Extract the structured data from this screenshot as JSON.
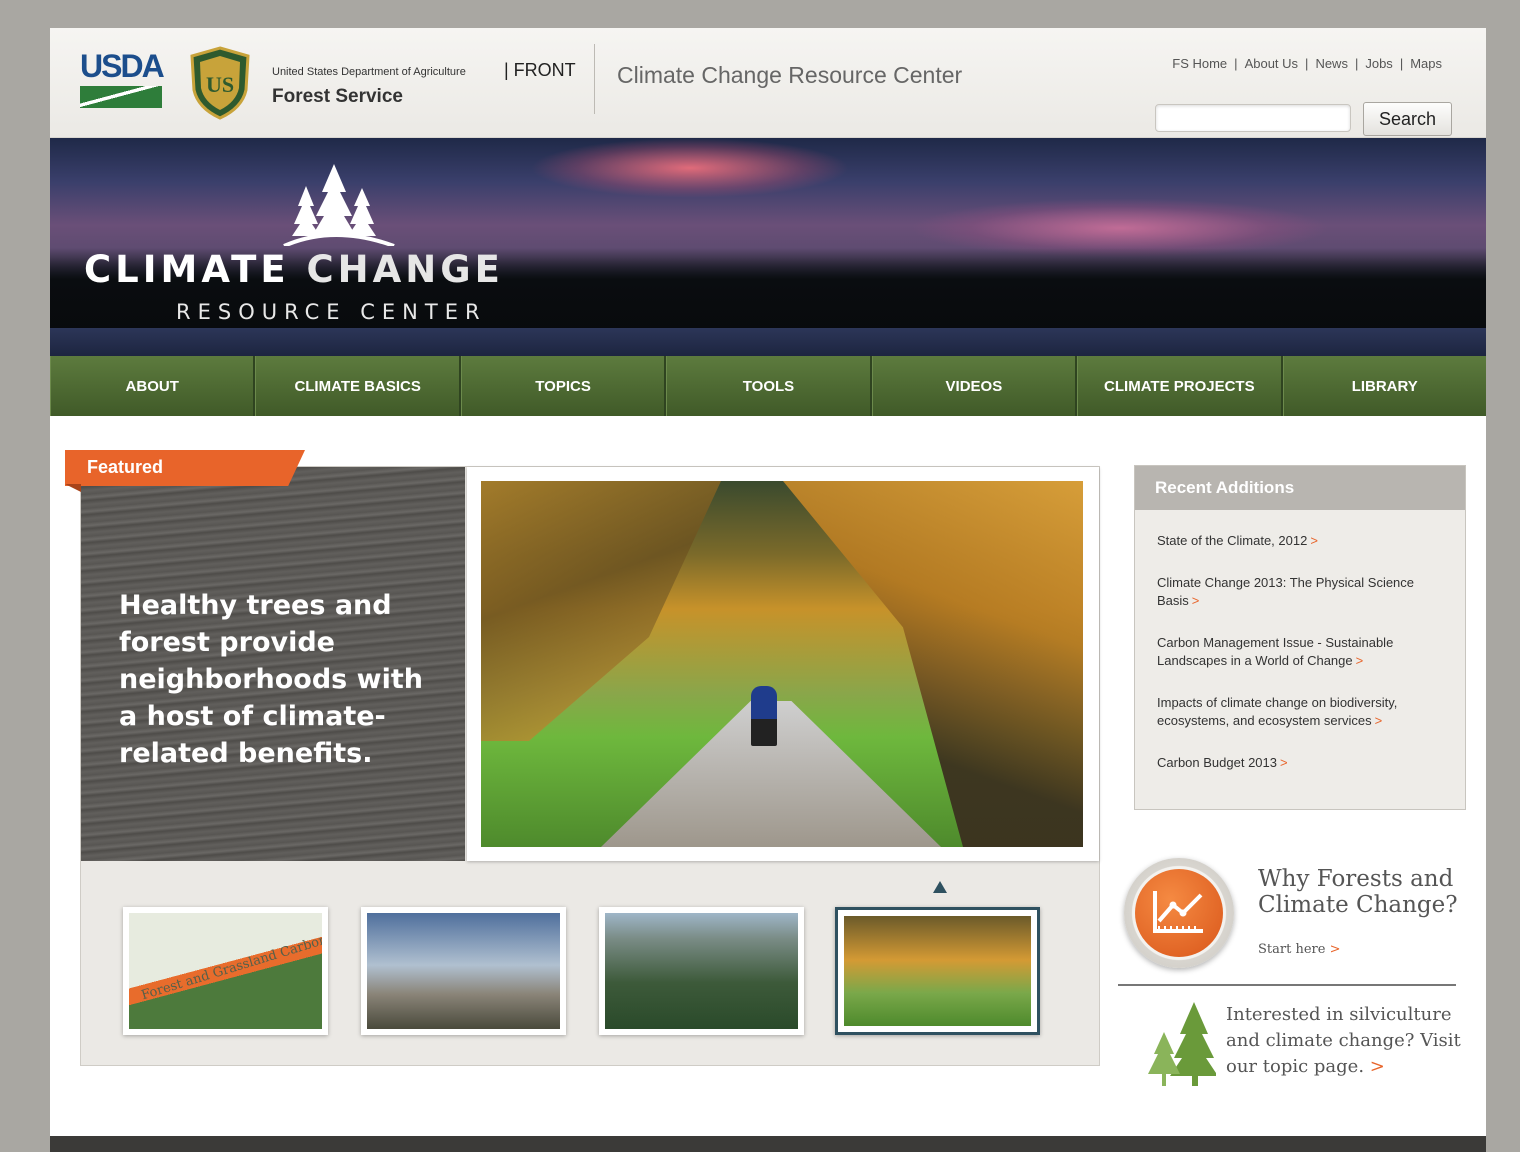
{
  "header": {
    "usda_logo_text": "USDA",
    "agency_small": "United States Department of Agriculture",
    "agency_front": "| FRONT",
    "agency_big": "Forest Service",
    "site_title": "Climate Change Resource Center",
    "top_links": [
      "FS Home",
      "About Us",
      "News",
      "Jobs",
      "Maps"
    ],
    "search": {
      "placeholder": "",
      "value": "",
      "button_label": "Search"
    }
  },
  "banner": {
    "title_part1": "CLIMATE",
    "title_part2": "CHANGE",
    "subtitle": "RESOURCE CENTER"
  },
  "nav": {
    "items": [
      "ABOUT",
      "CLIMATE BASICS",
      "TOPICS",
      "TOOLS",
      "VIDEOS",
      "CLIMATE PROJECTS",
      "LIBRARY"
    ]
  },
  "featured": {
    "tab_label": "Featured",
    "heading": "Healthy trees and forest provide neighborhoods with a host of climate-related benefits.",
    "thumbnails": [
      {
        "caption": "Forest and Grassland Carbon in North America"
      },
      {
        "caption": ""
      },
      {
        "caption": ""
      },
      {
        "caption": ""
      }
    ],
    "active_thumbnail": 4
  },
  "recent_additions": {
    "title": "Recent Additions",
    "items": [
      "State of the Climate, 2012",
      "Climate Change 2013: The Physical Science Basis",
      "Carbon Management Issue - Sustainable Landscapes in a World of Change",
      "Impacts of climate change on biodiversity, ecosystems, and ecosystem services",
      "Carbon Budget 2013"
    ],
    "arrow": ">"
  },
  "why_forests": {
    "title": "Why Forests and Climate Change?",
    "link": "Start here",
    "arrow": ">"
  },
  "silviculture": {
    "text": "Interested in silviculture and climate change? Visit our topic page.",
    "arrow": ">"
  },
  "colors": {
    "nav_green": "#4e6a33",
    "accent_orange": "#e8642a",
    "usda_blue": "#1c4e8c"
  }
}
